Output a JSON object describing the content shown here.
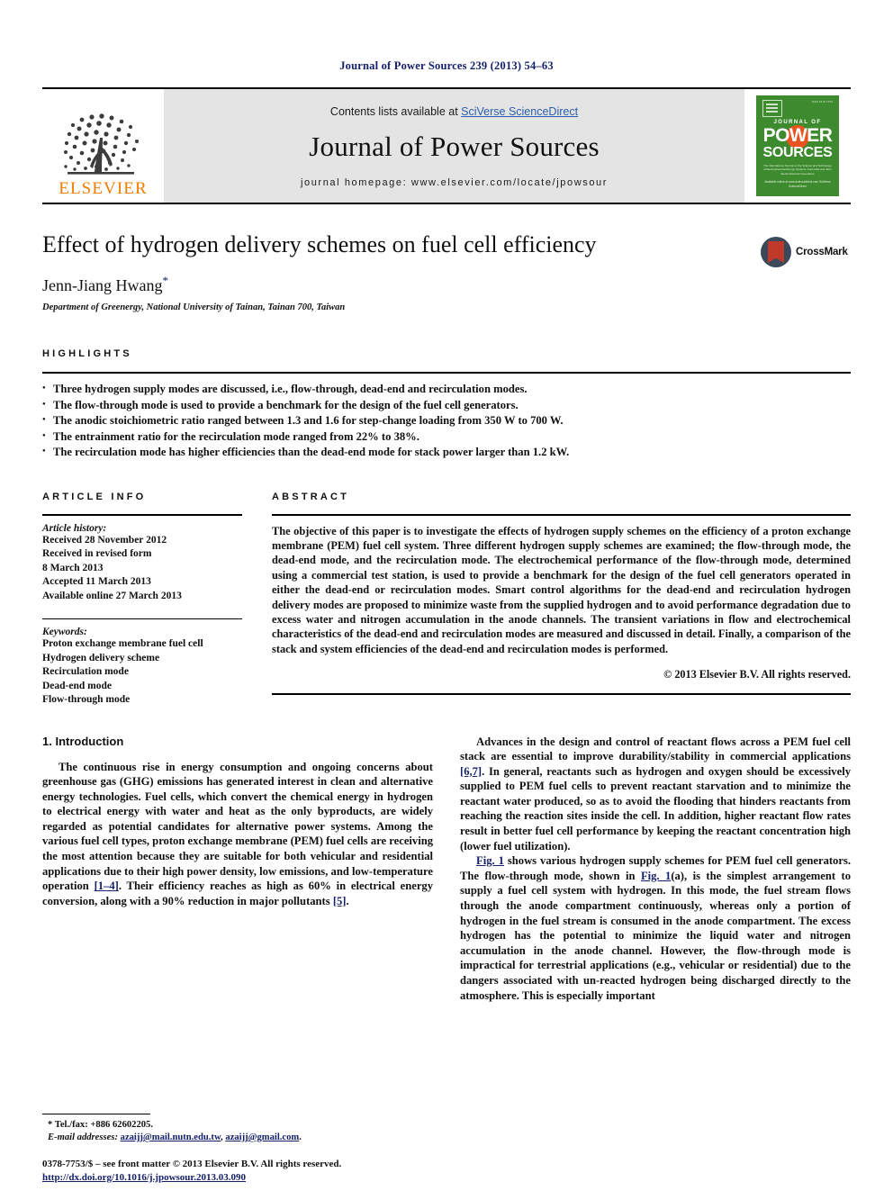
{
  "running_head": "Journal of Power Sources 239 (2013) 54–63",
  "masthead": {
    "publisher_name": "ELSEVIER",
    "contents_prefix": "Contents lists available at ",
    "contents_link": "SciVerse ScienceDirect",
    "journal_title": "Journal of Power Sources",
    "homepage": "journal homepage: www.elsevier.com/locate/jpowsour",
    "cover": {
      "issn": "ISSN 0378-7753",
      "journal_of": "JOURNAL OF",
      "power": "POWER",
      "sources": "SOURCES",
      "subtitle": "The International Journal on the Science and Technology of Electrochemical Energy Systems: Fuel Cells and other Electrochemical Generators",
      "footer": "Available online at www.sciencedirect.com\nSciVerse ScienceDirect"
    }
  },
  "article": {
    "title": "Effect of hydrogen delivery schemes on fuel cell efficiency",
    "author": "Jenn-Jiang Hwang",
    "author_marker": "*",
    "affiliation": "Department of Greenergy, National University of Tainan, Tainan 700, Taiwan",
    "crossmark_label": "CrossMark"
  },
  "highlights": {
    "heading": "HIGHLIGHTS",
    "items": [
      "Three hydrogen supply modes are discussed, i.e., flow-through, dead-end and recirculation modes.",
      "The flow-through mode is used to provide a benchmark for the design of the fuel cell generators.",
      "The anodic stoichiometric ratio ranged between 1.3 and 1.6 for step-change loading from 350 W to 700 W.",
      "The entrainment ratio for the recirculation mode ranged from 22% to 38%.",
      "The recirculation mode has higher efficiencies than the dead-end mode for stack power larger than 1.2 kW."
    ]
  },
  "article_info": {
    "heading": "ARTICLE INFO",
    "history_label": "Article history:",
    "history": [
      "Received 28 November 2012",
      "Received in revised form",
      "8 March 2013",
      "Accepted 11 March 2013",
      "Available online 27 March 2013"
    ],
    "keywords_label": "Keywords:",
    "keywords": [
      "Proton exchange membrane fuel cell",
      "Hydrogen delivery scheme",
      "Recirculation mode",
      "Dead-end mode",
      "Flow-through mode"
    ]
  },
  "abstract": {
    "heading": "ABSTRACT",
    "text": "The objective of this paper is to investigate the effects of hydrogen supply schemes on the efficiency of a proton exchange membrane (PEM) fuel cell system. Three different hydrogen supply schemes are examined; the flow-through mode, the dead-end mode, and the recirculation mode. The electrochemical performance of the flow-through mode, determined using a commercial test station, is used to provide a benchmark for the design of the fuel cell generators operated in either the dead-end or recirculation modes. Smart control algorithms for the dead-end and recirculation hydrogen delivery modes are proposed to minimize waste from the supplied hydrogen and to avoid performance degradation due to excess water and nitrogen accumulation in the anode channels. The transient variations in flow and electrochemical characteristics of the dead-end and recirculation modes are measured and discussed in detail. Finally, a comparison of the stack and system efficiencies of the dead-end and recirculation modes is performed.",
    "copyright": "© 2013 Elsevier B.V. All rights reserved."
  },
  "body": {
    "section_number_title": "1. Introduction",
    "left_paragraph_1_a": "The continuous rise in energy consumption and ongoing concerns about greenhouse gas (GHG) emissions has generated interest in clean and alternative energy technologies. Fuel cells, which convert the chemical energy in hydrogen to electrical energy with water and heat as the only byproducts, are widely regarded as potential candidates for alternative power systems. Among the various fuel cell types, proton exchange membrane (PEM) fuel cells are receiving the most attention because they are suitable for both vehicular and residential applications due to their high power density, low emissions, and low-temperature operation ",
    "left_ref_1": "[1–4]",
    "left_paragraph_1_b": ". Their efficiency reaches as high as 60% in electrical energy conversion, along with a 90% reduction in major pollutants ",
    "left_ref_2": "[5]",
    "left_paragraph_1_c": ".",
    "right_paragraph_1_a": "Advances in the design and control of reactant flows across a PEM fuel cell stack are essential to improve durability/stability in commercial applications ",
    "right_ref_1": "[6,7]",
    "right_paragraph_1_b": ". In general, reactants such as hydrogen and oxygen should be excessively supplied to PEM fuel cells to prevent reactant starvation and to minimize the reactant water produced, so as to avoid the flooding that hinders reactants from reaching the reaction sites inside the cell. In addition, higher reactant flow rates result in better fuel cell performance by keeping the reactant concentration high (lower fuel utilization).",
    "right_fig_ref_1": "Fig. 1",
    "right_paragraph_2_a": " shows various hydrogen supply schemes for PEM fuel cell generators. The flow-through mode, shown in ",
    "right_fig_ref_2": "Fig. 1",
    "right_paragraph_2_b": "(a), is the simplest arrangement to supply a fuel cell system with hydrogen. In this mode, the fuel stream flows through the anode compartment continuously, whereas only a portion of hydrogen in the fuel stream is consumed in the anode compartment. The excess hydrogen has the potential to minimize the liquid water and nitrogen accumulation in the anode channel. However, the flow-through mode is impractical for terrestrial applications (e.g., vehicular or residential) due to the dangers associated with un-reacted hydrogen being discharged directly to the atmosphere. This is especially important"
  },
  "footnotes": {
    "tel_marker": "*",
    "tel": "Tel./fax: +886 62602205.",
    "email_label": "E-mail addresses:",
    "email_1": "azaijj@mail.nutn.edu.tw",
    "email_sep": ", ",
    "email_2": "azaijj@gmail.com",
    "email_end": "."
  },
  "imprint": {
    "line": "0378-7753/$ – see front matter © 2013 Elsevier B.V. All rights reserved.",
    "doi": "http://dx.doi.org/10.1016/j.jpowsour.2013.03.090"
  }
}
